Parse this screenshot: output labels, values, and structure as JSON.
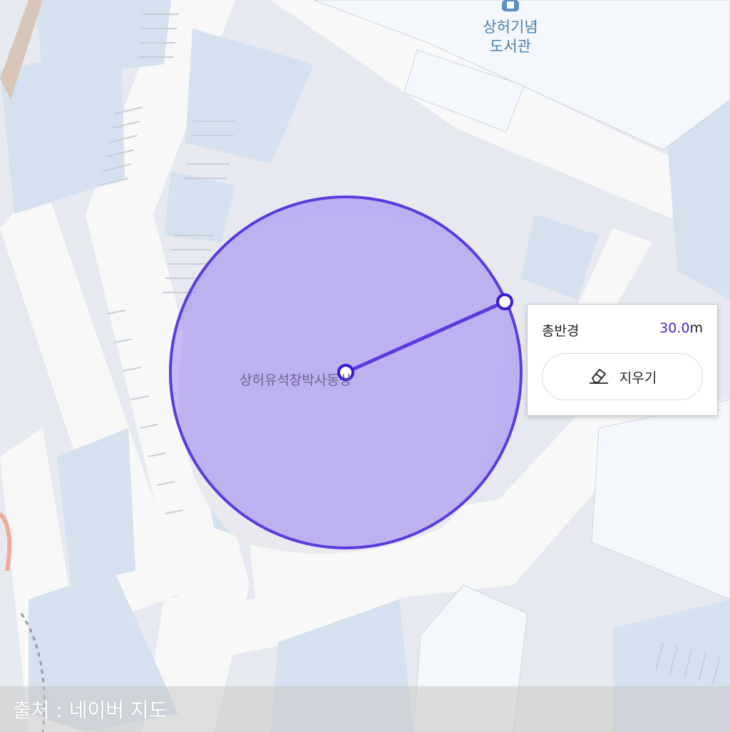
{
  "map": {
    "poi": {
      "line1": "상허기념",
      "line2": "도서관"
    },
    "place_label": "상허유석창박사동상",
    "colors": {
      "circle_stroke": "#5b3be0",
      "circle_fill": "#8a6cf0"
    }
  },
  "measure_popup": {
    "label": "총반경",
    "value_number": "30.0",
    "value_unit": "m",
    "erase_button_label": "지우기"
  },
  "footer": {
    "source_text": "출처 : 네이버 지도"
  }
}
